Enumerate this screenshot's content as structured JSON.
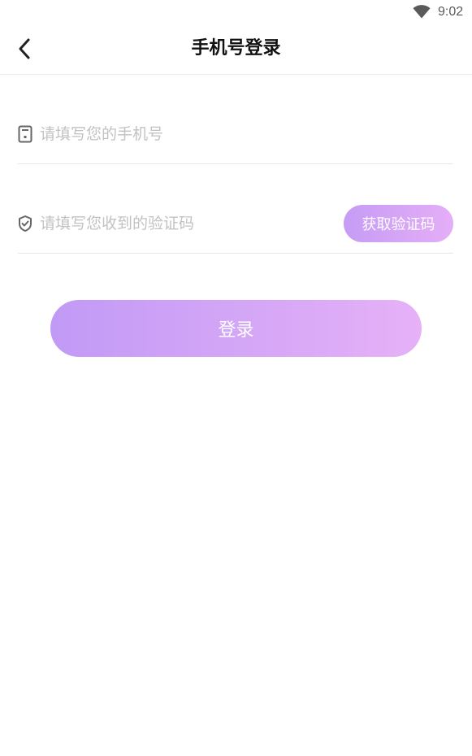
{
  "status_bar": {
    "time": "9:02",
    "wifi_icon": "wifi-icon"
  },
  "nav": {
    "back_icon": "chevron-left-icon",
    "title": "手机号登录"
  },
  "form": {
    "phone": {
      "icon": "phone-icon",
      "placeholder": "请填写您的手机号",
      "value": ""
    },
    "code": {
      "icon": "shield-check-icon",
      "placeholder": "请填写您收到的验证码",
      "value": "",
      "get_code_label": "获取验证码"
    },
    "login_label": "登录"
  },
  "colors": {
    "accent_start": "#c19af6",
    "accent_end": "#e6b1f7",
    "placeholder": "#c2c2c2",
    "divider": "#e6e6e6"
  }
}
